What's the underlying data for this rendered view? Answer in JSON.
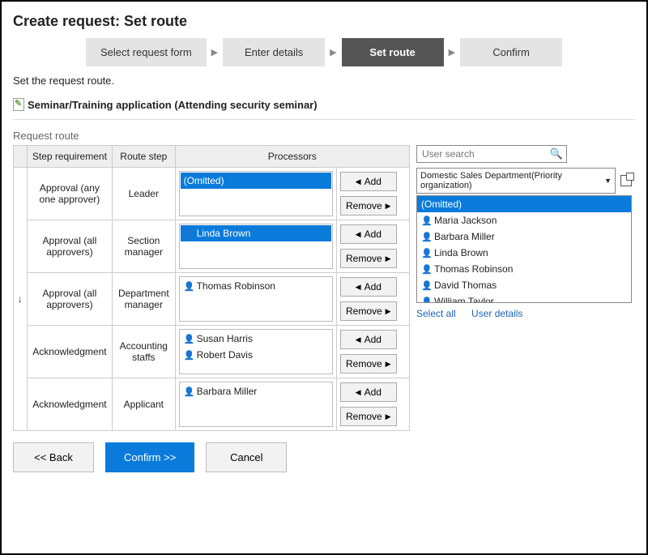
{
  "page_title": "Create request: Set route",
  "wizard": {
    "steps": [
      "Select request form",
      "Enter details",
      "Set route",
      "Confirm"
    ],
    "active_index": 2
  },
  "instruction": "Set the request route.",
  "form_name": "Seminar/Training application (Attending security seminar)",
  "section_label": "Request route",
  "table": {
    "headers": {
      "step_req": "Step requirement",
      "route_step": "Route step",
      "processors": "Processors"
    },
    "rows": [
      {
        "step_req": "Approval (any one approver)",
        "role": "Leader",
        "processors": [
          {
            "name": "(Omitted)",
            "selected": true,
            "icon": ""
          }
        ]
      },
      {
        "step_req": "Approval (all approvers)",
        "role": "Section manager",
        "processors": [
          {
            "name": "Linda Brown",
            "selected": true,
            "icon": "blue"
          }
        ]
      },
      {
        "step_req": "Approval (all approvers)",
        "role": "Department manager",
        "processors": [
          {
            "name": "Thomas Robinson",
            "selected": false,
            "icon": "blue"
          }
        ]
      },
      {
        "step_req": "Acknowledgment",
        "role": "Accounting staffs",
        "processors": [
          {
            "name": "Susan Harris",
            "selected": false,
            "icon": "blue"
          },
          {
            "name": "Robert Davis",
            "selected": false,
            "icon": "blue"
          }
        ]
      },
      {
        "step_req": "Acknowledgment",
        "role": "Applicant",
        "processors": [
          {
            "name": "Barbara Miller",
            "selected": false,
            "icon": "green"
          }
        ]
      }
    ],
    "add_label": "Add",
    "remove_label": "Remove"
  },
  "picker": {
    "search_placeholder": "User search",
    "org_selected": "Domestic Sales Department(Priority organization)",
    "users": [
      {
        "name": "(Omitted)",
        "selected": true,
        "icon": ""
      },
      {
        "name": "Maria Jackson",
        "selected": false,
        "icon": "blue"
      },
      {
        "name": "Barbara Miller",
        "selected": false,
        "icon": "green"
      },
      {
        "name": "Linda Brown",
        "selected": false,
        "icon": "blue"
      },
      {
        "name": "Thomas Robinson",
        "selected": false,
        "icon": "blue"
      },
      {
        "name": "David Thomas",
        "selected": false,
        "icon": "blue"
      },
      {
        "name": "William Taylor",
        "selected": false,
        "icon": "blue"
      }
    ],
    "select_all": "Select all",
    "user_details": "User details"
  },
  "footer": {
    "back": "<< Back",
    "confirm": "Confirm >>",
    "cancel": "Cancel"
  }
}
